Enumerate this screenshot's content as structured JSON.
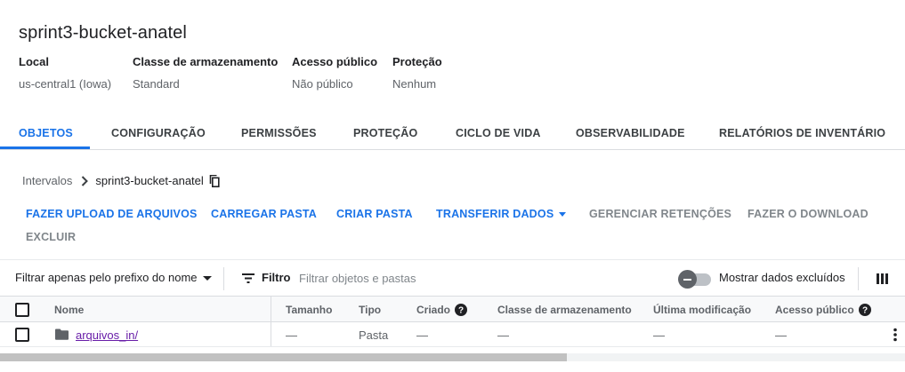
{
  "bucket": {
    "title": "sprint3-bucket-anatel",
    "meta": [
      {
        "label": "Local",
        "value": "us-central1 (Iowa)"
      },
      {
        "label": "Classe de armazenamento",
        "value": "Standard"
      },
      {
        "label": "Acesso público",
        "value": "Não público"
      },
      {
        "label": "Proteção",
        "value": "Nenhum"
      }
    ]
  },
  "tabs": [
    {
      "label": "OBJETOS",
      "active": true
    },
    {
      "label": "CONFIGURAÇÃO"
    },
    {
      "label": "PERMISSÕES"
    },
    {
      "label": "PROTEÇÃO"
    },
    {
      "label": "CICLO DE VIDA"
    },
    {
      "label": "OBSERVABILIDADE"
    },
    {
      "label": "RELATÓRIOS DE INVENTÁRIO"
    }
  ],
  "breadcrumb": {
    "root": "Intervalos",
    "current": "sprint3-bucket-anatel",
    "separator_icon": "chevron-right-icon",
    "copy_icon": "copy-icon"
  },
  "actions": {
    "upload_files": "FAZER UPLOAD DE ARQUIVOS",
    "upload_folder": "CARREGAR PASTA",
    "create_folder": "CRIAR PASTA",
    "transfer_data": "TRANSFERIR DADOS",
    "manage_holds": "GERENCIAR RETENÇÕES",
    "download": "FAZER O DOWNLOAD",
    "delete": "EXCLUIR"
  },
  "filter_bar": {
    "prefix_filter": "Filtrar apenas pelo prefixo do nome",
    "filter_label": "Filtro",
    "filter_placeholder": "Filtrar objetos e pastas",
    "show_deleted_label": "Mostrar dados excluídos",
    "show_deleted_enabled": false
  },
  "table": {
    "columns": {
      "name": "Nome",
      "size": "Tamanho",
      "type": "Tipo",
      "created": "Criado",
      "storage_class": "Classe de armazenamento",
      "last_modified": "Última modificação",
      "public_access": "Acesso público"
    },
    "rows": [
      {
        "name": "arquivos_in/",
        "size": "—",
        "type": "Pasta",
        "created": "—",
        "storage_class": "—",
        "last_modified": "—",
        "public_access": "—"
      }
    ]
  },
  "colors": {
    "accent": "#1a73e8",
    "visited_link": "#681da8",
    "disabled_action": "#80868b"
  }
}
